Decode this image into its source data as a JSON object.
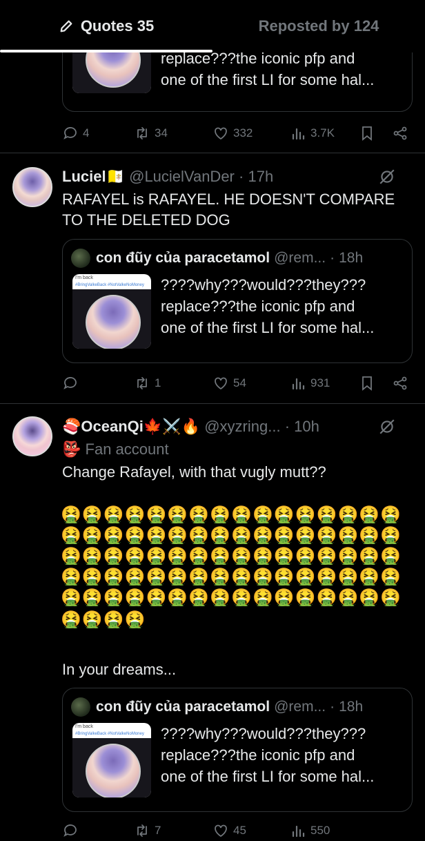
{
  "tabs": [
    {
      "label": "Quotes 35",
      "active": true
    },
    {
      "label": "Reposted by 124",
      "active": false
    }
  ],
  "top_quote": {
    "text_lines": [
      "replace???the iconic pfp and",
      "one of the first LI for some hal..."
    ],
    "thumb_text_1": "I'm back",
    "thumb_text_2": "#BringValkeBack #NotValkeNoMoney"
  },
  "top_actions": {
    "replies": "4",
    "reposts": "34",
    "likes": "332",
    "views": "3.7K"
  },
  "tweet1": {
    "name": "Luciel",
    "badge": "🇻🇦",
    "handle": "@LucielVanDer",
    "sep": "·",
    "time": "17h",
    "text_lines": [
      "RAFAYEL is RAFAYEL. HE DOESN'T COMPARE",
      "TO THE DELETED DOG"
    ],
    "quote": {
      "name": "con đũy của paracetamol",
      "handle": "@rem...",
      "sep": "·",
      "time": "18h",
      "text_lines": [
        "????why???would???they???",
        "replace???the iconic pfp and",
        "one of the first LI for some hal..."
      ],
      "thumb_text_1": "I'm back",
      "thumb_text_2": "#BringValkeBack #NotValkeNoMoney"
    },
    "actions": {
      "replies": "",
      "reposts": "1",
      "likes": "54",
      "views": "931"
    }
  },
  "tweet2": {
    "name_prefix": "🍣",
    "name": "OceanQi",
    "name_suffix": "🍁⚔️🔥",
    "handle": "@xyzring...",
    "sep": "·",
    "time": "10h",
    "label_icon": "👺",
    "label": "Fan account",
    "text_first": "Change Rafayel, with that vugly mutt??",
    "emoji_rows": [
      "🤮🤮🤮🤮🤮🤮🤮🤮🤮🤮🤮🤮🤮🤮🤮🤮",
      "🤮🤮🤮🤮🤮🤮🤮🤮🤮🤮🤮🤮🤮🤮🤮🤮",
      "🤮🤮🤮🤮🤮🤮🤮🤮🤮🤮🤮🤮🤮🤮🤮🤮",
      "🤮🤮🤮🤮🤮🤮🤮🤮🤮🤮🤮🤮🤮🤮🤮🤮",
      "🤮🤮🤮🤮🤮🤮🤮🤮🤮🤮🤮🤮🤮🤮🤮🤮",
      "🤮🤮🤮🤮"
    ],
    "text_last": "In your dreams...",
    "quote": {
      "name": "con đũy của paracetamol",
      "handle": "@rem...",
      "sep": "·",
      "time": "18h",
      "text_lines": [
        "????why???would???they???",
        "replace???the iconic pfp and",
        "one of the first LI for some hal..."
      ],
      "thumb_text_1": "I'm back",
      "thumb_text_2": "#BringValkeBack #NotValkeNoMoney"
    },
    "actions": {
      "replies": "",
      "reposts": "7",
      "likes": "45",
      "views": "550"
    }
  },
  "colors": {
    "background": "#000000",
    "text": "#e7e9ea",
    "muted": "#71767b",
    "border": "#2f3336"
  }
}
